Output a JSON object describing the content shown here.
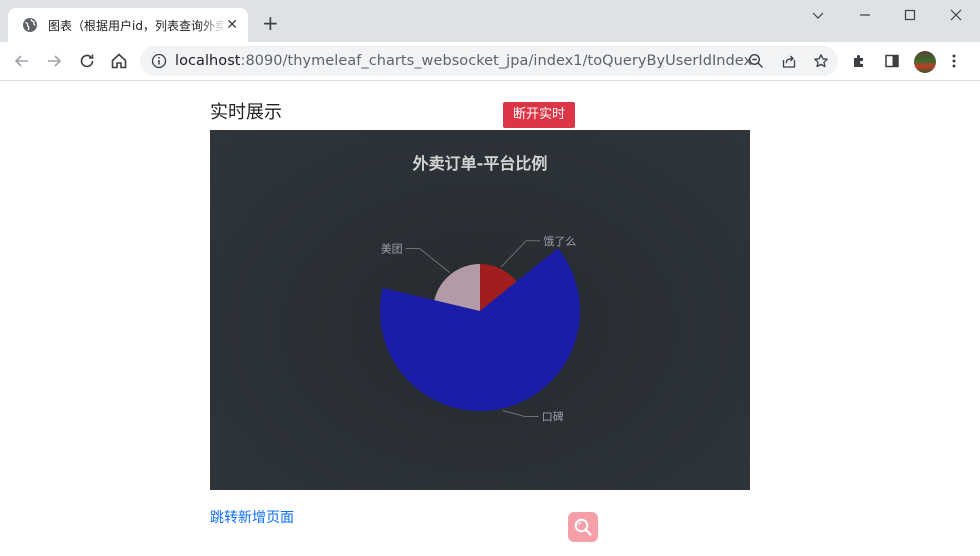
{
  "browser": {
    "tab_title": "图表（根据用户id，列表查询外卖",
    "url_host": "localhost",
    "url_rest": ":8090/thymeleaf_charts_websocket_jpa/index1/toQueryByUserIdIndex",
    "icons": [
      "globe-icon",
      "close-icon",
      "plus-icon",
      "minimize-icon",
      "maximize-icon",
      "window-close-icon",
      "back-icon",
      "forward-icon",
      "reload-icon",
      "home-icon",
      "info-icon",
      "zoom-icon",
      "share-icon",
      "star-icon",
      "extensions-icon",
      "sidepanel-icon",
      "menu-icon"
    ]
  },
  "page": {
    "heading": "实时展示",
    "disconnect_button": "断开实时",
    "jump_link": "跳转新增页面"
  },
  "chart_data": {
    "type": "pie",
    "rose": true,
    "title": "外卖订单-平台比例",
    "series": [
      {
        "name": "饿了么",
        "value": 22,
        "color": "#a11e1e"
      },
      {
        "name": "口碑",
        "value": 100,
        "color": "#1b1da8"
      },
      {
        "name": "美团",
        "value": 33,
        "color": "#b39aa8"
      }
    ],
    "label_color": "#9aa0a6",
    "background": "#2c3338"
  }
}
